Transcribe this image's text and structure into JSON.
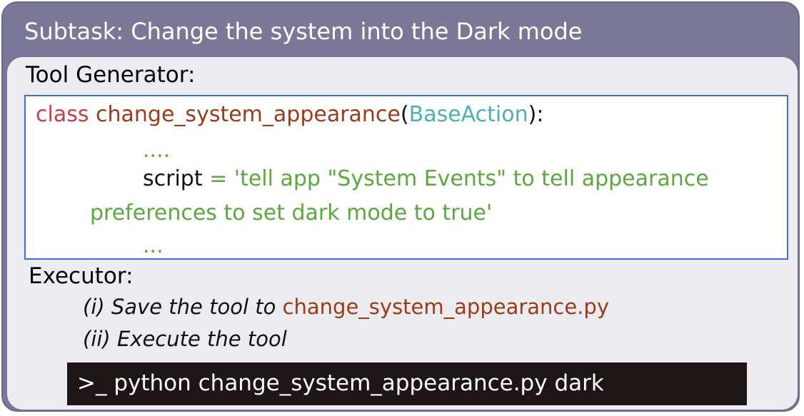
{
  "title": "Subtask: Change the system into the Dark mode",
  "tool_generator": {
    "label": "Tool Generator:",
    "code": {
      "keyword_class": "class",
      "class_name": "change_system_appearance",
      "open_paren": "(",
      "base_class": "BaseAction",
      "close_paren_colon": "):",
      "ellipsis_top": "....",
      "script_var": "script",
      "assign_op": " = ",
      "script_value_line1": "'tell app \"System Events\" to tell appearance",
      "script_value_line2": "preferences to set dark mode to true'",
      "ellipsis_bottom": "..."
    }
  },
  "executor": {
    "label": "Executor:",
    "step1_prefix": "(i) Save the tool to ",
    "step1_file": "change_system_appearance.py",
    "step2": "(ii) Execute the tool",
    "command": ">_ python change_system_appearance.py dark"
  },
  "colors": {
    "outer_background": "#7a7896",
    "inner_background": "#ececf0",
    "code_border": "#3a6fd1",
    "keyword": "#c1404e",
    "class_name": "#9a3b1a",
    "base_class": "#4ab2b2",
    "string": "#5aa83e",
    "terminal_background": "#1e1616"
  }
}
